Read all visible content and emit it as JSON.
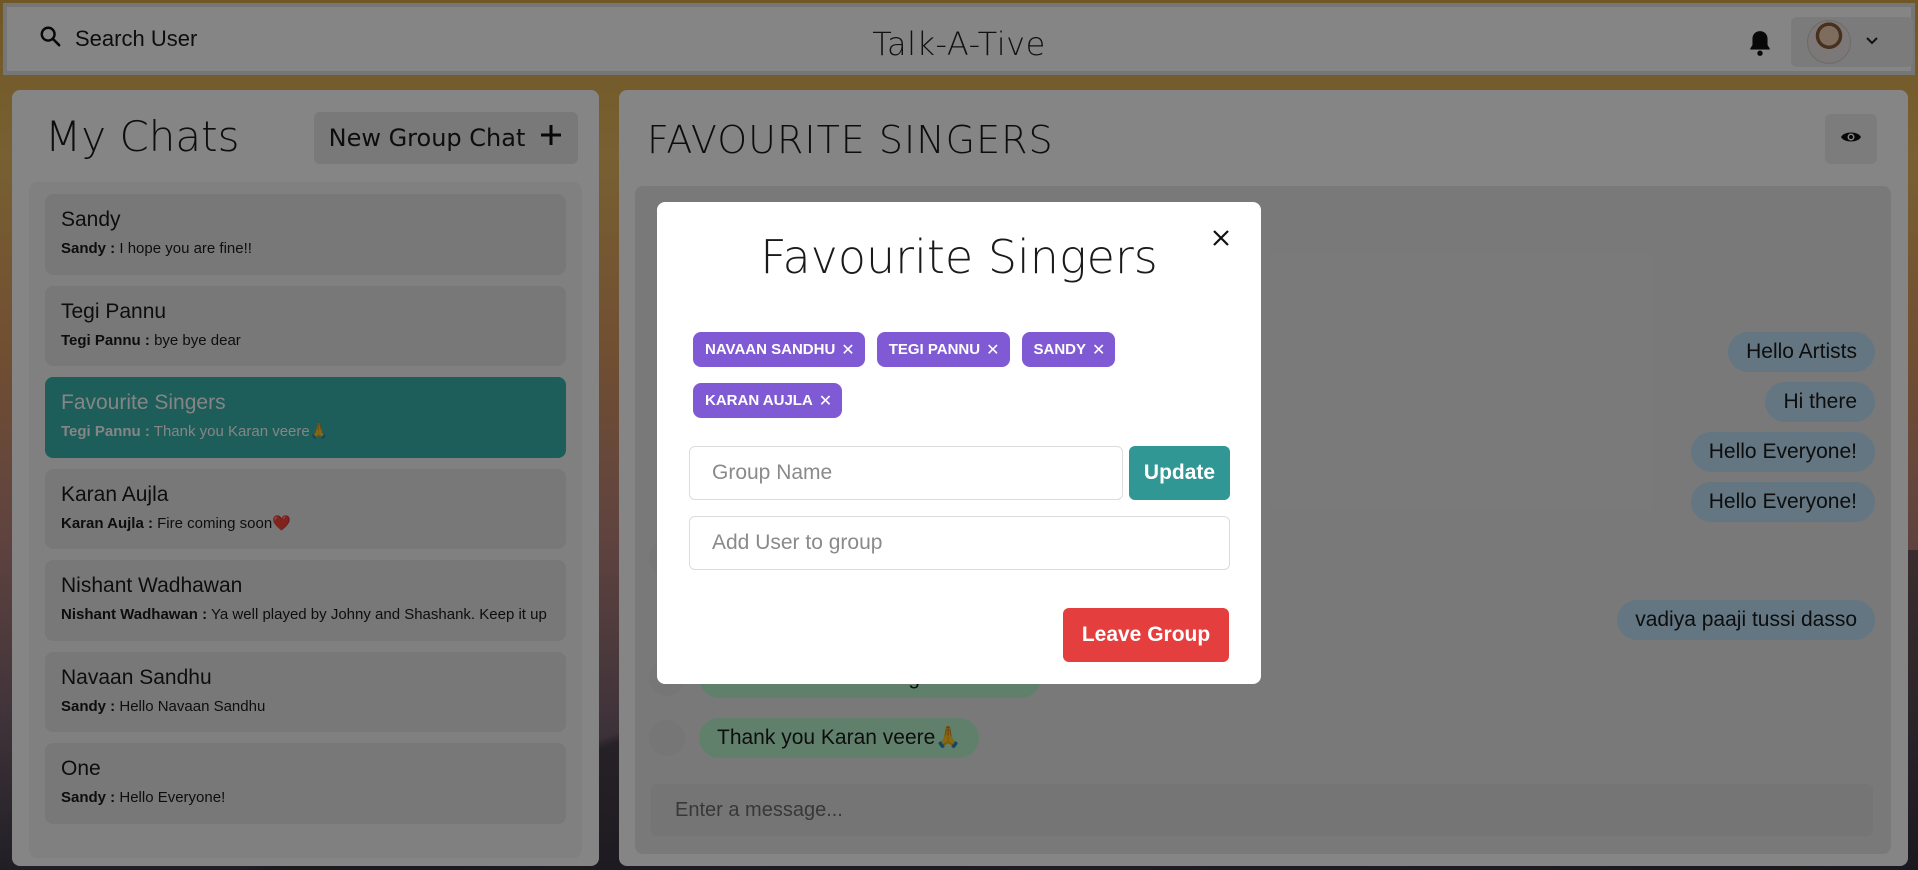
{
  "header": {
    "search_label": "Search User",
    "app_title": "Talk-A-Tive"
  },
  "sidebar": {
    "title": "My Chats",
    "new_group_label": "New Group Chat",
    "chats": [
      {
        "name": "Sandy",
        "sender": "Sandy :",
        "preview": "I hope you are fine!!"
      },
      {
        "name": "Tegi Pannu",
        "sender": "Tegi Pannu :",
        "preview": "bye bye dear"
      },
      {
        "name": "Favourite Singers",
        "sender": "Tegi Pannu :",
        "preview": "Thank you Karan veere🙏"
      },
      {
        "name": "Karan Aujla",
        "sender": "Karan Aujla :",
        "preview": "Fire coming soon❤️"
      },
      {
        "name": "Nishant Wadhawan",
        "sender": "Nishant Wadhawan :",
        "preview": "Ya well played by Johny and Shashank. Keep it up"
      },
      {
        "name": "Navaan Sandhu",
        "sender": "Sandy :",
        "preview": "Hello Navaan Sandhu"
      },
      {
        "name": "One",
        "sender": "Sandy :",
        "preview": "Hello Everyone!"
      }
    ]
  },
  "main": {
    "title": "FAVOURITE SINGERS",
    "messages": [
      {
        "text": "Hello Artists",
        "side": "me"
      },
      {
        "text": "Hi there",
        "side": "me"
      },
      {
        "text": "Hello Everyone!",
        "side": "me"
      },
      {
        "text": "Hello Everyone!",
        "side": "me"
      },
      {
        "text": "vadiya paaji tussi dasso",
        "side": "me"
      },
      {
        "text": "Addicted track fire tegi te navaan",
        "side": "them"
      },
      {
        "text": "Thank you Karan veere🙏",
        "side": "them"
      }
    ],
    "input_placeholder": "Enter a message..."
  },
  "modal": {
    "title": "Favourite Singers",
    "members": [
      "NAVAAN SANDHU",
      "TEGI PANNU",
      "SANDY",
      "KARAN AUJLA"
    ],
    "group_name_placeholder": "Group Name",
    "update_label": "Update",
    "add_user_placeholder": "Add User to group",
    "leave_label": "Leave Group"
  },
  "colors": {
    "accent_teal": "#38B2AC",
    "tag_purple": "#805AD5",
    "update_teal": "#319795",
    "leave_red": "#E53E3E"
  }
}
